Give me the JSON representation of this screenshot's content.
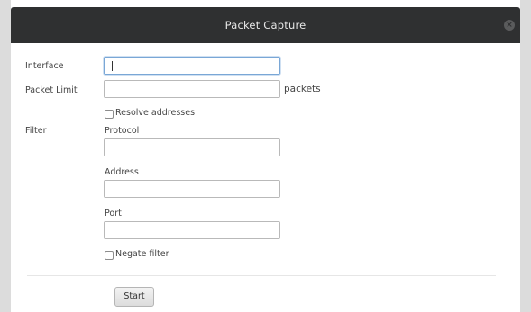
{
  "dialog": {
    "title": "Packet Capture",
    "close_icon": "close-icon"
  },
  "form": {
    "interface_label": "Interface",
    "interface_value": "",
    "packet_limit_label": "Packet Limit",
    "packet_limit_value": "",
    "packets_unit": "packets",
    "resolve_addresses_label": "Resolve addresses",
    "resolve_addresses_checked": false,
    "filter_label": "Filter",
    "protocol_label": "Protocol",
    "protocol_value": "",
    "address_label": "Address",
    "address_value": "",
    "port_label": "Port",
    "port_value": "",
    "negate_filter_label": "Negate filter",
    "negate_filter_checked": false
  },
  "actions": {
    "start_label": "Start"
  },
  "colors": {
    "titlebar": "#2f3031",
    "focus_border": "#7aa7d6"
  }
}
